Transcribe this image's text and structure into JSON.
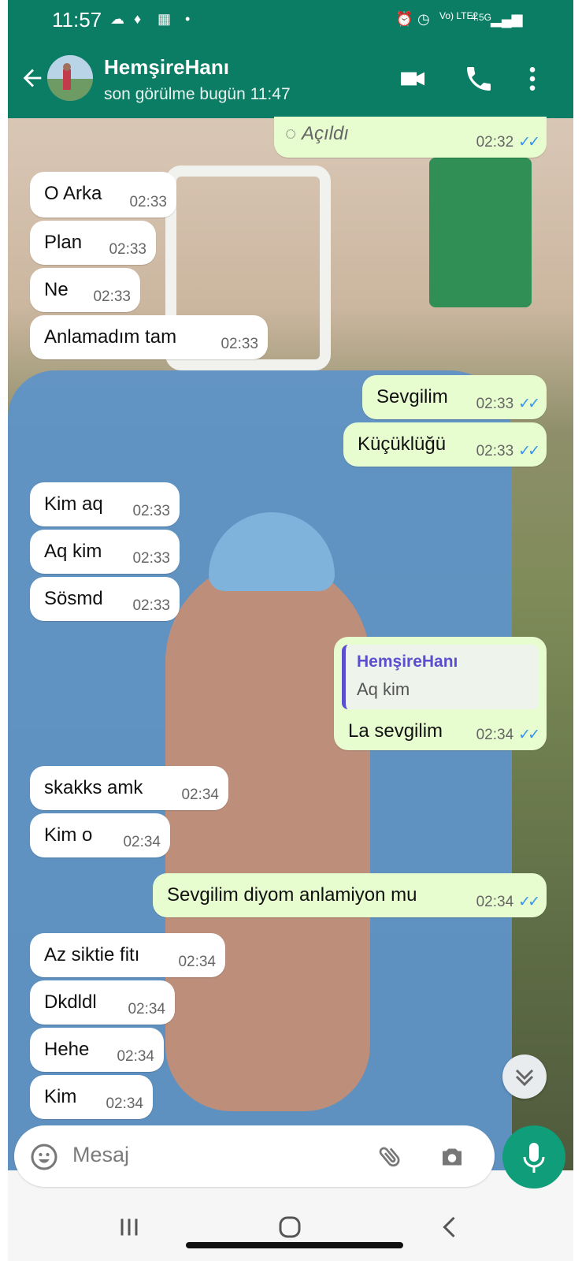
{
  "status_bar": {
    "time": "11:57",
    "right_icons": [
      "alarm-icon",
      "clock-icon",
      "volte-icon",
      "signal-icon",
      "battery-icon"
    ],
    "network_label": "Vo) LTE2",
    "net_type": "4.5G"
  },
  "header": {
    "contact_name": "HemşireHanı",
    "last_seen": "son görülme bugün 11:47"
  },
  "messages": [
    {
      "text": "Açıldı",
      "time": "02:32",
      "outgoing": true
    },
    {
      "text": "O Arka",
      "time": "02:33",
      "outgoing": false
    },
    {
      "text": "Plan",
      "time": "02:33",
      "outgoing": false
    },
    {
      "text": "Ne",
      "time": "02:33",
      "outgoing": false
    },
    {
      "text": "Anlamadım tam",
      "time": "02:33",
      "outgoing": false
    },
    {
      "text": "Sevgilim",
      "time": "02:33",
      "outgoing": true
    },
    {
      "text": "Küçüklüğü",
      "time": "02:33",
      "outgoing": true
    },
    {
      "text": "Kim aq",
      "time": "02:33",
      "outgoing": false
    },
    {
      "text": "Aq kim",
      "time": "02:33",
      "outgoing": false
    },
    {
      "text": "Sösmd",
      "time": "02:33",
      "outgoing": false
    },
    {
      "text": "La sevgilim",
      "time": "02:34",
      "outgoing": true,
      "quote": {
        "author": "HemşireHanı",
        "text": "Aq kim"
      }
    },
    {
      "text": "skakks amk",
      "time": "02:34",
      "outgoing": false
    },
    {
      "text": "Kim o",
      "time": "02:34",
      "outgoing": false
    },
    {
      "text": "Sevgilim diyom anlamiyon mu",
      "time": "02:34",
      "outgoing": true
    },
    {
      "text": "Az siktie fitı",
      "time": "02:34",
      "outgoing": false
    },
    {
      "text": "Dkdldl",
      "time": "02:34",
      "outgoing": false
    },
    {
      "text": "Hehe",
      "time": "02:34",
      "outgoing": false
    },
    {
      "text": "Kim",
      "time": "02:34",
      "outgoing": false
    }
  ],
  "input": {
    "placeholder": "Mesaj"
  },
  "colors": {
    "header": "#0b7d65",
    "outgoing_bubble": "#e7fccf",
    "incoming_bubble": "#ffffff",
    "read_tick": "#3b93f0",
    "mic_button": "#0f9d7a",
    "quote_bar": "#5b4fcf"
  }
}
